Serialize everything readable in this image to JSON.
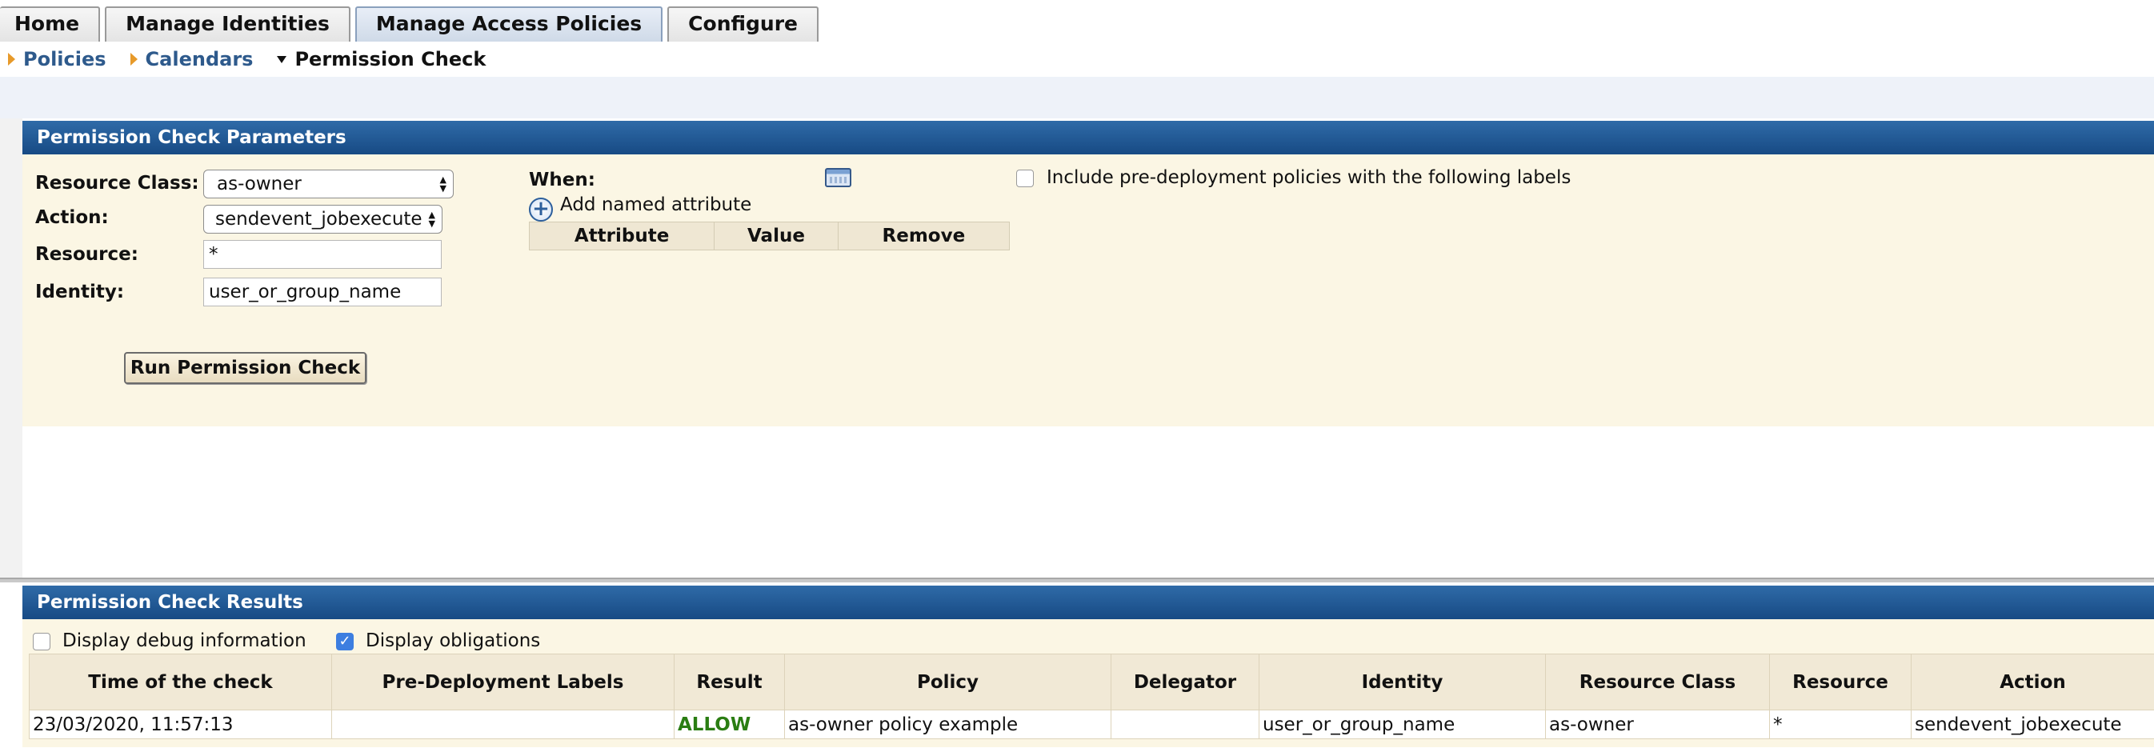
{
  "tabs": [
    {
      "label": "Home"
    },
    {
      "label": "Manage Identities"
    },
    {
      "label": "Manage Access Policies"
    },
    {
      "label": "Configure"
    }
  ],
  "subnav": [
    {
      "label": "Policies"
    },
    {
      "label": "Calendars"
    },
    {
      "label": "Permission Check"
    }
  ],
  "params": {
    "title": "Permission Check Parameters",
    "resource_class_label": "Resource Class:",
    "resource_class_value": "as-owner",
    "action_label": "Action:",
    "action_value": "sendevent_jobexecute",
    "resource_label": "Resource:",
    "resource_value": "*",
    "identity_label": "Identity:",
    "identity_value": "user_or_group_name",
    "when_label": "When:",
    "add_attribute_label": "Add named attribute",
    "attribute_columns": [
      "Attribute",
      "Value",
      "Remove"
    ],
    "include_predeploy_label": "Include pre-deployment policies with the following labels",
    "include_predeploy_checked": false,
    "run_button": "Run Permission Check"
  },
  "results": {
    "title": "Permission Check Results",
    "debug_label": "Display debug information",
    "debug_checked": false,
    "obligations_label": "Display obligations",
    "obligations_checked": true,
    "columns": [
      "Time of the check",
      "Pre-Deployment Labels",
      "Result",
      "Policy",
      "Delegator",
      "Identity",
      "Resource Class",
      "Resource",
      "Action"
    ],
    "rows": [
      {
        "time": "23/03/2020, 11:57:13",
        "labels": "",
        "result": "ALLOW",
        "policy": "as-owner policy example",
        "delegator": "",
        "identity": "user_or_group_name",
        "resource_class": "as-owner",
        "resource": "*",
        "action": "sendevent_jobexecute"
      }
    ]
  },
  "colors": {
    "panel_header": "#1f5590",
    "panel_body": "#fbf6e4",
    "allow": "#2a7d12",
    "link": "#2e5a8c"
  }
}
